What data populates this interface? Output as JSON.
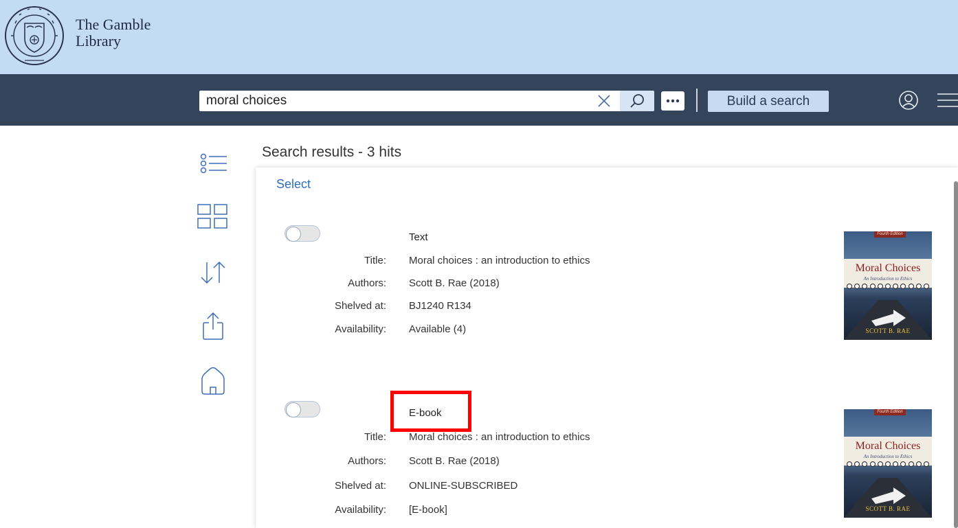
{
  "header": {
    "library_name_line1": "The Gamble",
    "library_name_line2": "Library",
    "logo_text": "UNION THEOLOGICAL COLLEGE 1853"
  },
  "search": {
    "query": "moral choices",
    "build_label": "Build a search"
  },
  "toolbar": {
    "items": [
      "list-view",
      "grid-view",
      "sort",
      "export",
      "home"
    ]
  },
  "results": {
    "title": "Search results - 3 hits",
    "select_label": "Select",
    "labels": {
      "title": "Title:",
      "authors": "Authors:",
      "shelved": "Shelved at:",
      "availability": "Availability:"
    },
    "items": [
      {
        "type": "Text",
        "title": "Moral choices : an introduction to ethics",
        "authors": "Scott B. Rae (2018)",
        "shelved": "BJ1240 R134",
        "availability": "Available (4)",
        "cover": {
          "edition": "Fourth Edition",
          "title": "Moral Choices",
          "subtitle": "An Introduction to Ethics",
          "author": "SCOTT B. RAE"
        }
      },
      {
        "type": "E-book",
        "title": "Moral choices : an introduction to ethics",
        "authors": "Scott B. Rae (2018)",
        "shelved": "ONLINE-SUBSCRIBED",
        "availability": "[E-book]",
        "cover": {
          "edition": "Fourth Edition",
          "title": "Moral Choices",
          "subtitle": "An Introduction to Ethics",
          "author": "SCOTT B. RAE"
        }
      }
    ]
  },
  "colors": {
    "banner": "#c3dbf5",
    "nav": "#34445a",
    "link": "#2f6fc0",
    "highlight": "#ff0000"
  }
}
